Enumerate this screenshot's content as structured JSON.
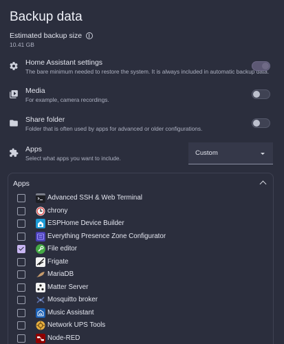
{
  "title": "Backup data",
  "estimate": {
    "label": "Estimated backup size",
    "value": "10.41 GB",
    "info_icon": "info-circle-icon"
  },
  "options": [
    {
      "id": "ha-settings",
      "icon": "gear-icon",
      "title": "Home Assistant settings",
      "description": "The bare minimum needed to restore the system. It is always included in automatic backup data.",
      "enabled": true
    },
    {
      "id": "media",
      "icon": "media-play-icon",
      "title": "Media",
      "description": "For example, camera recordings.",
      "enabled": false
    },
    {
      "id": "share",
      "icon": "folder-icon",
      "title": "Share folder",
      "description": "Folder that is often used by apps for advanced or older configurations.",
      "enabled": false
    },
    {
      "id": "apps",
      "icon": "puzzle-icon",
      "title": "Apps",
      "description": "Select what apps you want to include."
    }
  ],
  "apps_select": {
    "value": "Custom"
  },
  "apps_panel": {
    "header": "Apps",
    "items": [
      {
        "name": "Advanced SSH & Web Terminal",
        "checked": false,
        "icon": "terminal-icon",
        "color": "#1e1f24"
      },
      {
        "name": "chrony",
        "checked": false,
        "icon": "clock-icon",
        "color": "#f5f5f5"
      },
      {
        "name": "ESPHome Device Builder",
        "checked": false,
        "icon": "esphome-icon",
        "color": "#1d9bd6"
      },
      {
        "name": "Everything Presence Zone Configurator",
        "checked": false,
        "icon": "presence-icon",
        "color": "#4a3fb5"
      },
      {
        "name": "File editor",
        "checked": true,
        "icon": "wrench-icon",
        "color": "#44a845"
      },
      {
        "name": "Frigate",
        "checked": false,
        "icon": "frigate-icon",
        "color": "#f2f2f2"
      },
      {
        "name": "MariaDB",
        "checked": false,
        "icon": "seal-icon",
        "color": "#2b2e3d"
      },
      {
        "name": "Matter Server",
        "checked": false,
        "icon": "matter-icon",
        "color": "#f2f2f2"
      },
      {
        "name": "Mosquitto broker",
        "checked": false,
        "icon": "mosquitto-icon",
        "color": "#2b2e3d"
      },
      {
        "name": "Music Assistant",
        "checked": false,
        "icon": "music-icon",
        "color": "#1a5fb4"
      },
      {
        "name": "Network UPS Tools",
        "checked": false,
        "icon": "nut-icon",
        "color": "#e8b040"
      },
      {
        "name": "Node-RED",
        "checked": false,
        "icon": "node-red-icon",
        "color": "#8f0000"
      }
    ]
  },
  "colors": {
    "background": "#2b2e3d",
    "accent": "#c8b6f2",
    "text": "#e4e6ef",
    "muted": "#aeb2c2"
  }
}
